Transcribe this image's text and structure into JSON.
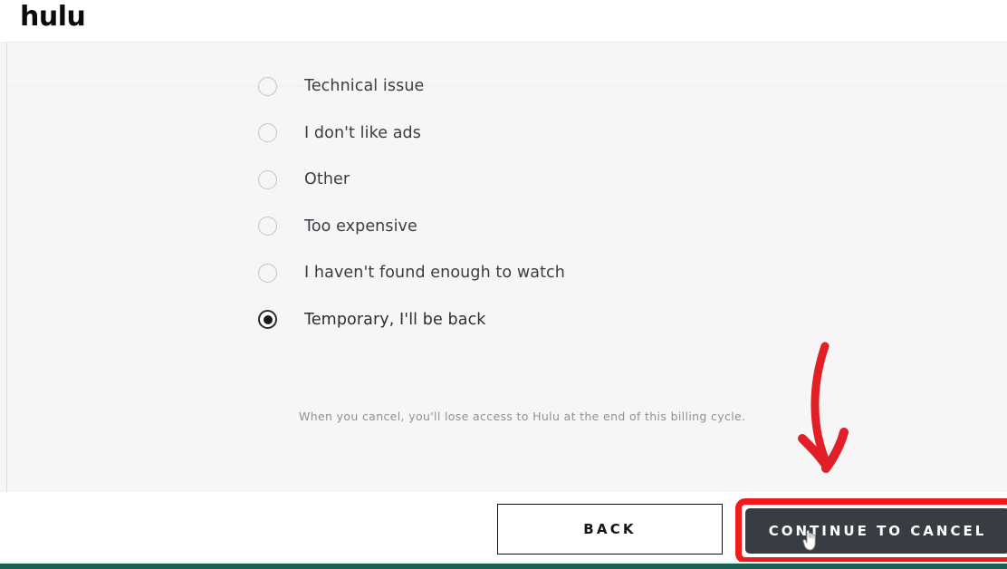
{
  "header": {
    "logo_text": "hulu"
  },
  "content": {
    "question_options": [
      {
        "label": "Technical issue",
        "selected": false
      },
      {
        "label": "I don't like ads",
        "selected": false
      },
      {
        "label": "Other",
        "selected": false
      },
      {
        "label": "Too expensive",
        "selected": false
      },
      {
        "label": "I haven't found enough to watch",
        "selected": false
      },
      {
        "label": "Temporary, I'll be back",
        "selected": true
      }
    ],
    "disclaimer": "When you cancel, you'll lose access to Hulu at the end of this billing cycle."
  },
  "footer": {
    "back_label": "BACK",
    "continue_label": "CONTINUE TO CANCEL"
  },
  "annotations": {
    "arrow_color": "#e01f26",
    "highlight_color": "#f01c1c"
  },
  "theme": {
    "page_background": "#ffffff",
    "content_background": "#f6f6f7",
    "cta_background": "#383c43",
    "text_color": "#3b3d44",
    "bottom_bar_color": "#1c5f55"
  }
}
